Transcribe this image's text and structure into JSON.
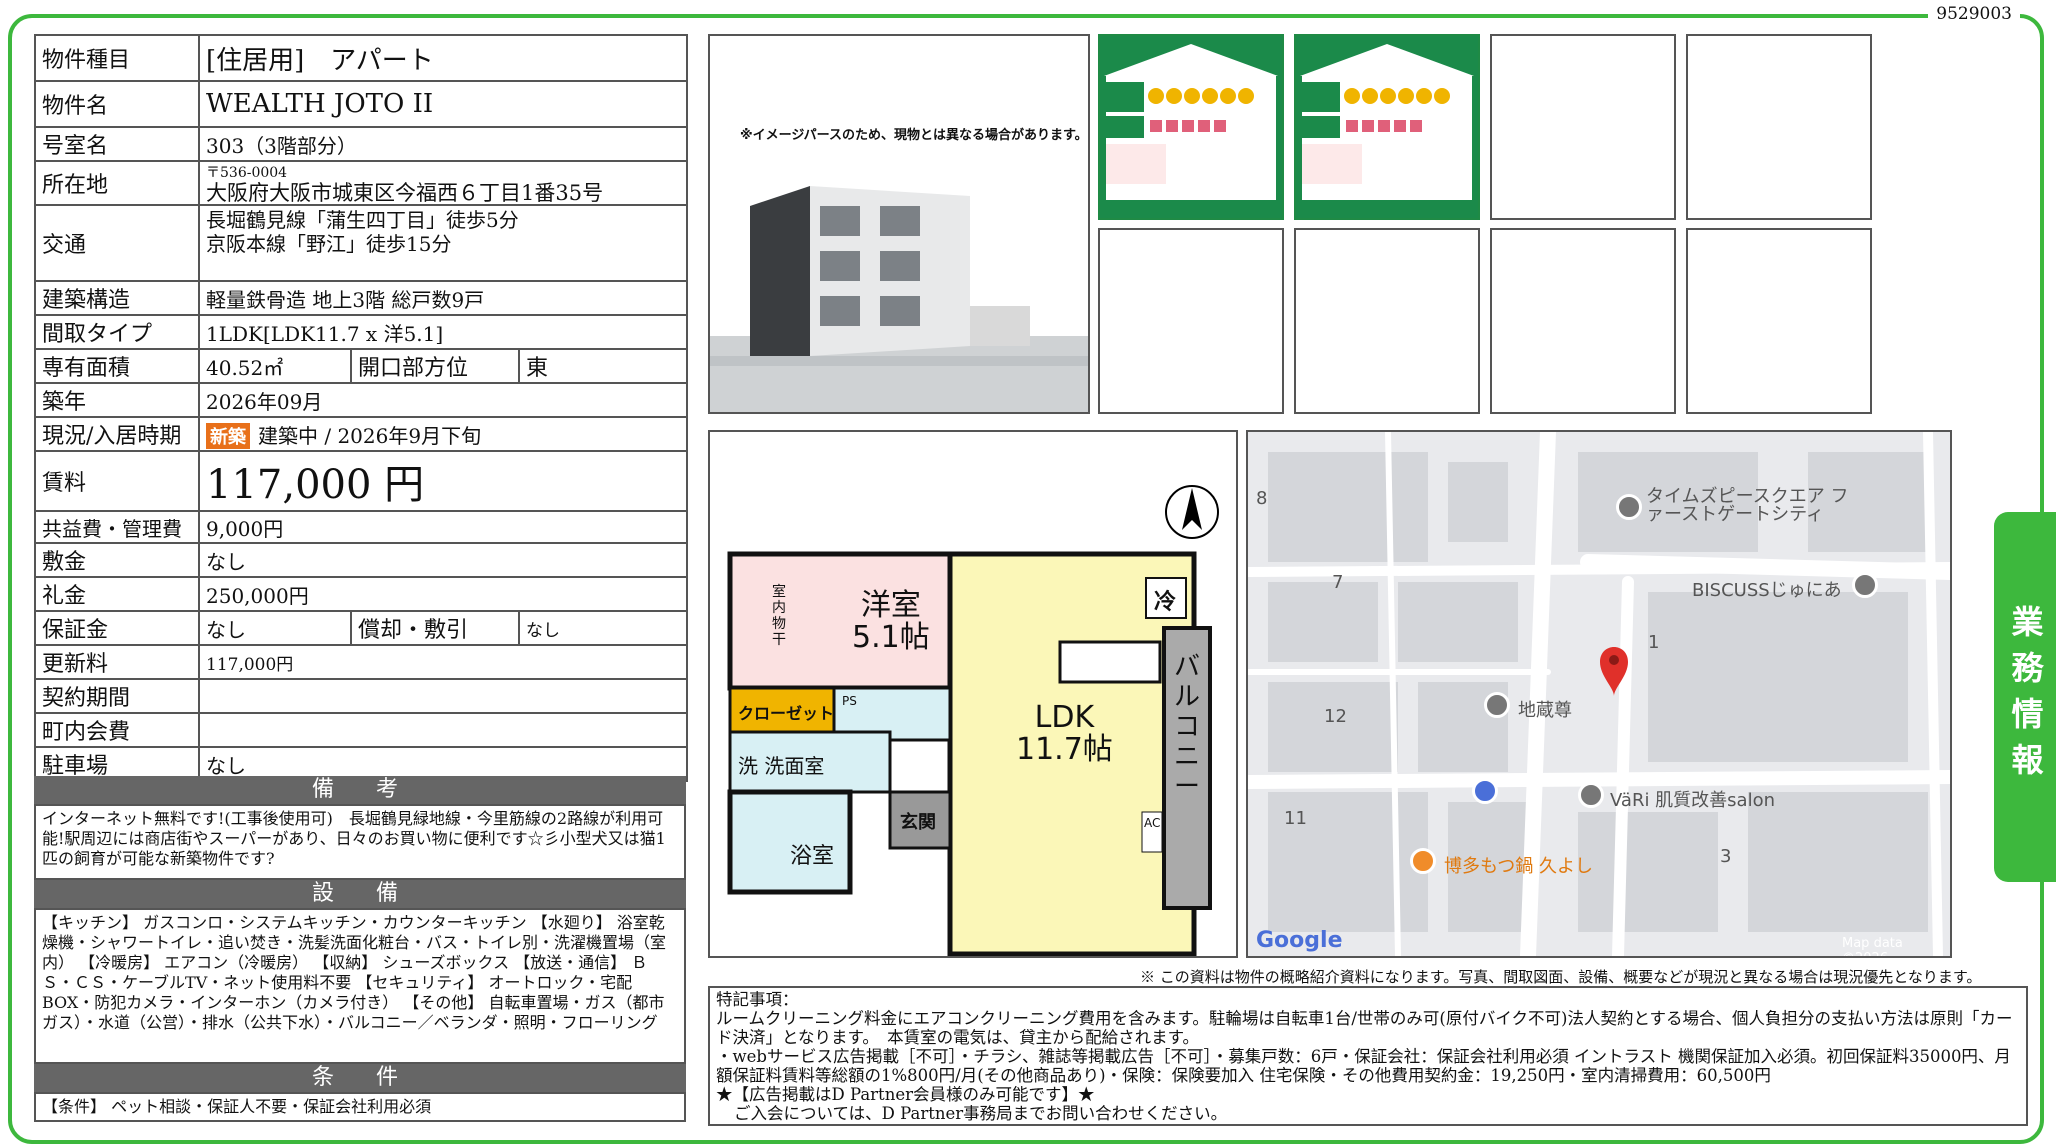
{
  "doc_id": "9529003",
  "side_tab": "業務情報",
  "property": {
    "type_label": "物件種目",
    "type": "[住居用]　アパート",
    "name_label": "物件名",
    "name": "WEALTH JOTO II",
    "room_label": "号室名",
    "room": "303（3階部分）",
    "address_label": "所在地",
    "postal": "〒536-0004",
    "address": "大阪府大阪市城東区今福西６丁目1番35号",
    "access_label": "交通",
    "access1": "長堀鶴見線「蒲生四丁目」徒歩5分",
    "access2": "京阪本線「野江」徒歩15分",
    "structure_label": "建築構造",
    "structure": "軽量鉄骨造 地上3階 総戸数9戸",
    "layout_label": "間取タイプ",
    "layout": "1LDK[LDK11.7 x 洋5.1]",
    "area_label": "専有面積",
    "area": "40.52㎡",
    "direction_label": "開口部方位",
    "direction": "東",
    "built_label": "築年",
    "built": "2026年09月",
    "status_label": "現況/入居時期",
    "status_badge": "新築",
    "status": "建築中 /  2026年9月下旬",
    "rent_label": "賃料",
    "rent": "117,000 円",
    "fee_label": "共益費・管理費",
    "fee": "9,000円",
    "deposit_label": "敷金",
    "deposit": "なし",
    "key_money_label": "礼金",
    "key_money": "250,000円",
    "guarantee_label": "保証金",
    "guarantee": "なし",
    "amortization_label": "償却・敷引",
    "amortization": "なし",
    "renewal_label": "更新料",
    "renewal": "117,000円",
    "term_label": "契約期間",
    "term": "",
    "assoc_label": "町内会費",
    "assoc": "",
    "parking_label": "駐車場",
    "parking": "なし"
  },
  "remarks": {
    "title": "備　考",
    "text": "インターネット無料です!(工事後使用可)　長堀鶴見緑地線・今里筋線の2路線が利用可能!駅周辺には商店街やスーパーがあり、日々のお買い物に便利です☆彡小型犬又は猫1匹の飼育が可能な新築物件です?"
  },
  "facilities": {
    "title": "設　備",
    "text": "【キッチン】 ガスコンロ・システムキッチン・カウンターキッチン 【水廻り】 浴室乾燥機・シャワートイレ・追い焚き・洗髪洗面化粧台・バス・トイレ別・洗濯機置場（室内） 【冷暖房】 エアコン（冷暖房） 【収納】 シューズボックス 【放送・通信】 ＢＳ・ＣＳ・ケーブルTV・ネット使用料不要 【セキュリティ】 オートロック・宅配BOX・防犯カメラ・インターホン（カメラ付き） 【その他】 自転車置場・ガス（都市ガス）・水道（公営）・排水（公共下水）・バルコニー／ベランダ・照明・フローリング"
  },
  "conditions": {
    "title": "条　件",
    "text": "【条件】 ペット相談・保証人不要・保証会社利用必須"
  },
  "image_caption": "※イメージパースのため、現物とは異なる場合があります。",
  "floorplan": {
    "western": "洋室",
    "western_size": "5.1帖",
    "ldk": "LDK",
    "ldk_size": "11.7帖",
    "closet": "クローゼット",
    "wash": "洗",
    "washroom": "洗面室",
    "bath": "浴室",
    "entrance": "玄関",
    "balcony": "バルコニー",
    "fridge": "冷",
    "ac": "AC",
    "ps": "PS",
    "indoor_dry": "室内物干"
  },
  "map": {
    "places": [
      "タイムズピースクエア ファーストゲートシティ",
      "BISCUSSじゅにあ",
      "地蔵尊",
      "VäRi 肌質改善salon",
      "博多もつ鍋 久よし"
    ],
    "blocks": [
      "8",
      "7",
      "1",
      "12",
      "11",
      "3"
    ],
    "logo": "Google",
    "credit": "Map data ©2026"
  },
  "disclaimer": "※ この資料は物件の概略紹介資料になります。写真、間取図面、設備、概要などが現況と異なる場合は現況優先となります。",
  "special": {
    "title": "特記事項：",
    "line1": "ルームクリーニング料金にエアコンクリーニング費用を含みます。駐輪場は自転車1台/世帯のみ可(原付バイク不可)法人契約とする場合、個人負担分の支払い方法は原則「カード決済」となります。　本賃室の電気は、貸主から配給されます。",
    "line2": "・webサービス広告掲載［不可］・チラシ、雑誌等掲載広告［不可］・募集戸数：6戸・保証会社：保証会社利用必須 イントラスト 機関保証加入必須。初回保証料35000円、月額保証料賃料等総額の1%800円/月(その他商品あり)・保険：保険要加入 住宅保険・その他費用契約金：19,250円・室内清掃費用：60,500円",
    "line3": "★【広告掲載はD Partner会員様のみ可能です】★",
    "line4": "ご入会については、D Partner事務局までお問い合わせください。"
  },
  "colors": {
    "accent": "#3db83d",
    "header": "#666666",
    "badge": "#e8701a",
    "label_green": "#1b8a4a"
  }
}
